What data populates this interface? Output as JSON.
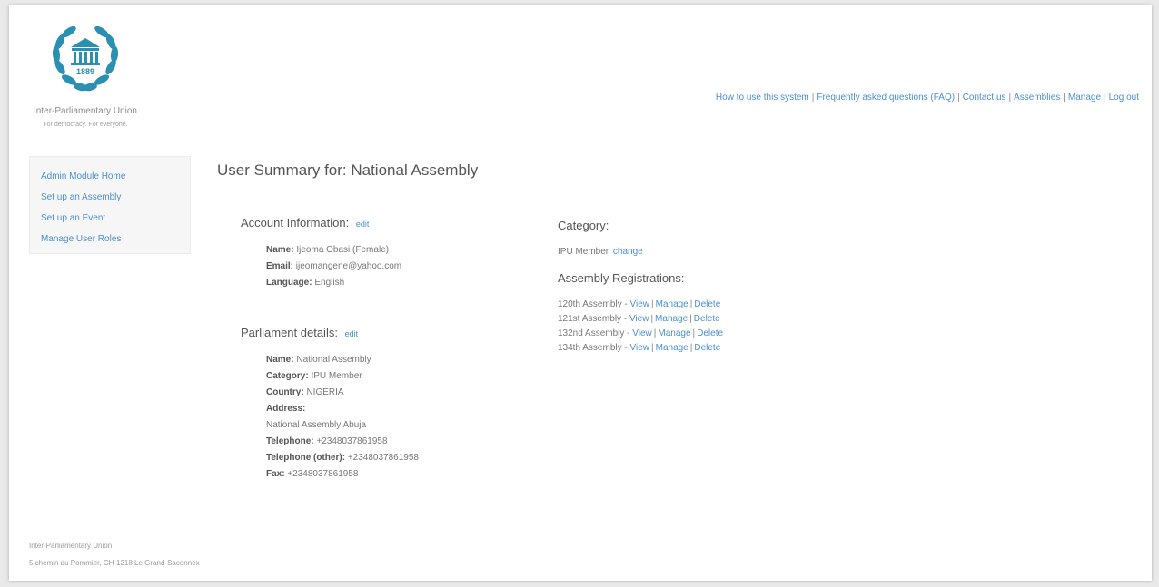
{
  "header": {
    "org_name": "Inter-Parliamentary Union",
    "org_tagline": "For democracy. For everyone.",
    "logo_year": "1889",
    "brand_color": "#2a8fb0",
    "nav": [
      {
        "label": "How to use this system"
      },
      {
        "label": "Frequently asked questions (FAQ)"
      },
      {
        "label": "Contact us"
      },
      {
        "label": "Assemblies"
      },
      {
        "label": "Manage"
      },
      {
        "label": "Log out"
      }
    ]
  },
  "sidebar": {
    "items": [
      {
        "label": "Admin Module Home"
      },
      {
        "label": "Set up an Assembly"
      },
      {
        "label": "Set up an Event"
      },
      {
        "label": "Manage User Roles"
      }
    ]
  },
  "main": {
    "title": "User Summary for: National Assembly",
    "account": {
      "heading": "Account Information:",
      "edit_label": "edit",
      "name_label": "Name:",
      "name_value": "Ijeoma Obasi (Female)",
      "email_label": "Email:",
      "email_value": "ijeomangene@yahoo.com",
      "language_label": "Language:",
      "language_value": "English"
    },
    "parliament": {
      "heading": "Parliament details:",
      "edit_label": "edit",
      "name_label": "Name:",
      "name_value": "National Assembly",
      "category_label": "Category:",
      "category_value": "IPU Member",
      "country_label": "Country:",
      "country_value": "NIGERIA",
      "address_label": "Address:",
      "address_value": "National Assembly Abuja",
      "telephone_label": "Telephone:",
      "telephone_value": "+2348037861958",
      "telephone_other_label": "Telephone (other):",
      "telephone_other_value": "+2348037861958",
      "fax_label": "Fax:",
      "fax_value": "+2348037861958"
    },
    "category": {
      "heading": "Category:",
      "value": "IPU Member",
      "change_label": "change"
    },
    "registrations": {
      "heading": "Assembly Registrations:",
      "view_label": "View",
      "manage_label": "Manage",
      "delete_label": "Delete",
      "items": [
        {
          "name": "120th Assembly"
        },
        {
          "name": "121st Assembly"
        },
        {
          "name": "132nd Assembly"
        },
        {
          "name": "134th Assembly"
        }
      ]
    }
  },
  "footer": {
    "line1": "Inter-Parliamentary Union",
    "line2": "5 chemin du Pommier, CH-1218 Le Grand-Saconnex"
  }
}
